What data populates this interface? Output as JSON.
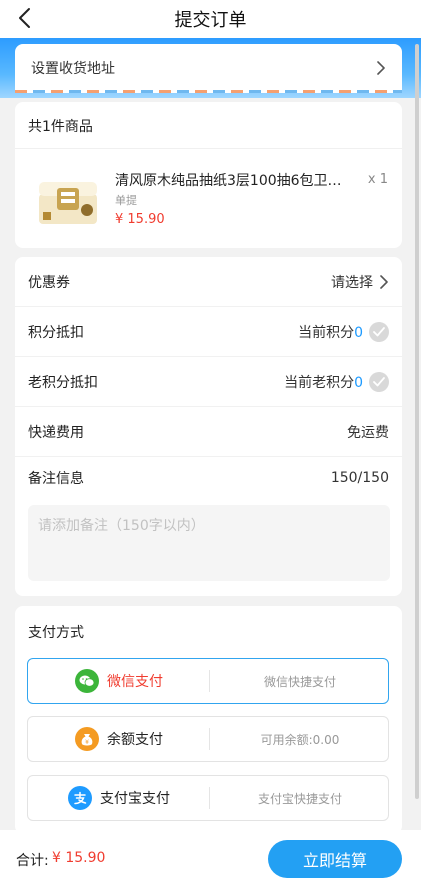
{
  "header": {
    "title": "提交订单"
  },
  "address": {
    "label": "设置收货地址"
  },
  "goods": {
    "count_label": "共1件商品",
    "items": [
      {
        "name": "清风原木纯品抽纸3层100抽6包卫…",
        "qty": "x 1",
        "spec": "单提",
        "price": "¥ 15.90"
      }
    ]
  },
  "options": {
    "coupon": {
      "label": "优惠券",
      "value": "请选择"
    },
    "points": {
      "label": "积分抵扣",
      "prefix": "当前积分",
      "value": "0"
    },
    "old_points": {
      "label": "老积分抵扣",
      "prefix": "当前老积分",
      "value": "0"
    },
    "shipping": {
      "label": "快递费用",
      "value": "免运费"
    },
    "note": {
      "label": "备注信息",
      "counter": "150/150",
      "placeholder": "请添加备注（150字以内）"
    }
  },
  "payment": {
    "title": "支付方式",
    "methods": [
      {
        "name": "微信支付",
        "desc": "微信快捷支付",
        "icon": "wechat-icon",
        "color": "#3cb53a",
        "selected": true
      },
      {
        "name": "余额支付",
        "desc": "可用余额:0.00",
        "icon": "balance-bag-icon",
        "color": "#f49b22",
        "selected": false
      },
      {
        "name": "支付宝支付",
        "desc": "支付宝快捷支付",
        "icon": "alipay-icon",
        "color": "#1e9bff",
        "selected": false
      }
    ]
  },
  "footer": {
    "total_label": "合计:",
    "total_value": "¥ 15.90",
    "submit_label": "立即结算"
  },
  "colors": {
    "accent": "#23a0f3",
    "price": "#f03c2f",
    "blue_band": "#2d9cff"
  }
}
